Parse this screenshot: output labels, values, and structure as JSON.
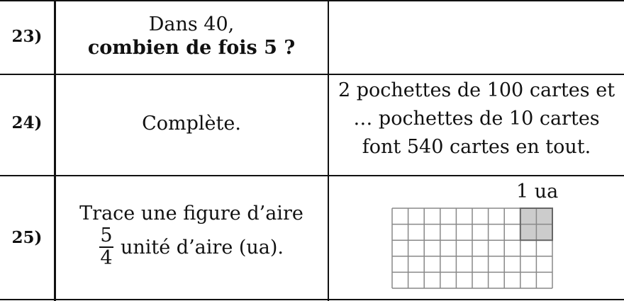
{
  "rows": [
    {
      "number": "23)",
      "question_line1": "Dans 40,",
      "question_line2": "combien de fois 5 ?",
      "answer_lines": []
    },
    {
      "number": "24)",
      "question": "Complète.",
      "answer_lines": [
        "2 pochettes de 100 cartes et",
        "…  pochettes de 10 cartes",
        "font 540 cartes en tout."
      ]
    },
    {
      "number": "25)",
      "question_line1": "Trace une figure d’aire",
      "fraction": {
        "numerator": "5",
        "denominator": "4"
      },
      "question_suffix": "unité d’aire (ua).",
      "grid": {
        "label": "1 ua",
        "columns": 10,
        "rows": 5,
        "unit_columns": 2,
        "unit_rows": 2,
        "unit_fill": "#cccccc",
        "line_color": "#888888"
      }
    }
  ]
}
